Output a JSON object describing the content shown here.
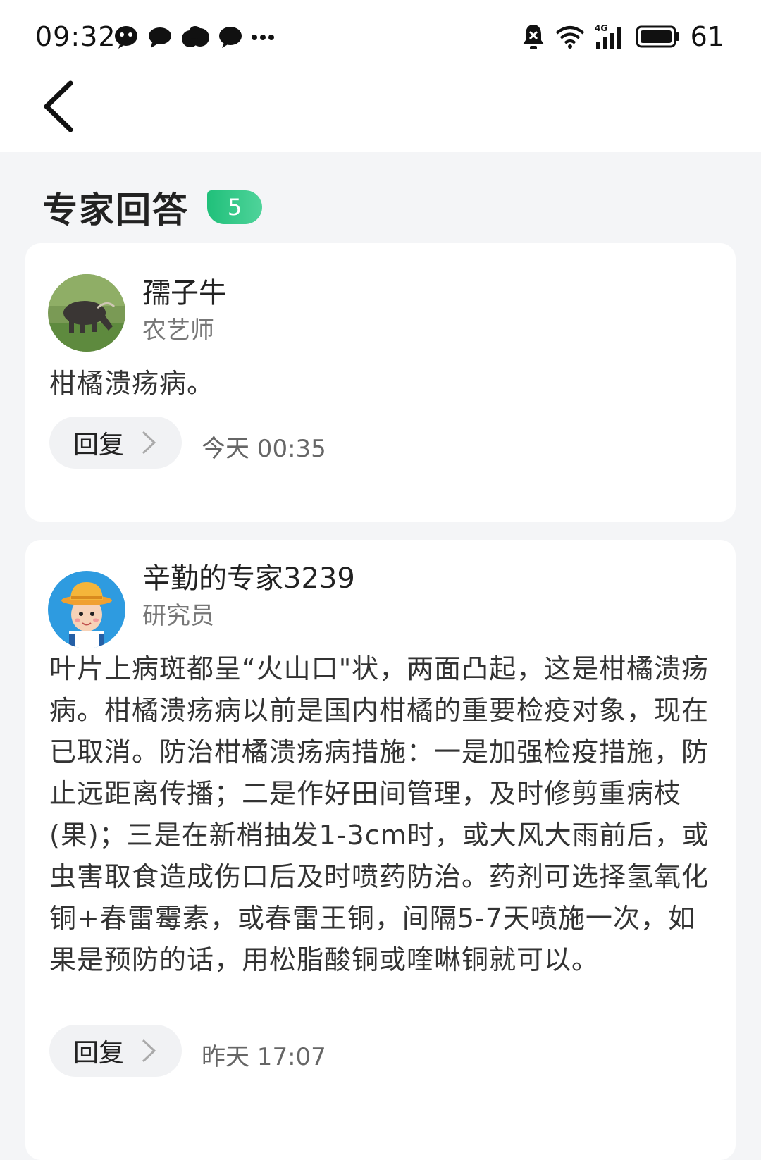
{
  "status_bar": {
    "time": "09:32",
    "battery": "61",
    "network": "4G",
    "icons": [
      "qq-icon",
      "chat-icon",
      "cloud-icon",
      "message-icon",
      "more-dots-icon",
      "mute-bell-icon",
      "wifi-icon",
      "signal-icon",
      "battery-icon"
    ]
  },
  "nav": {
    "back_icon": "back-arrow-icon"
  },
  "section": {
    "title": "专家回答",
    "count": "5"
  },
  "answers": [
    {
      "name": "孺子牛",
      "role": "农艺师",
      "avatar": "buffalo-avatar",
      "text": "柑橘溃疡病。",
      "reply_label": "回复",
      "time": "今天 00:35"
    },
    {
      "name": "辛勤的专家3239",
      "role": "研究员",
      "avatar": "farmer-avatar",
      "text": "叶片上病斑都呈“火山口\"状，两面凸起，这是柑橘溃疡病。柑橘溃疡病以前是国内柑橘的重要检疫对象，现在已取消。防治柑橘溃疡病措施：一是加强检疫措施，防止远距离传播；二是作好田间管理，及时修剪重病枝(果)；三是在新梢抽发1-3cm时，或大风大雨前后，或虫害取食造成伤口后及时喷药防治。药剂可选择氢氧化铜+春雷霉素，或春雷王铜，间隔5-7天喷施一次，如果是预防的话，用松脂酸铜或喹啉铜就可以。",
      "reply_label": "回复",
      "time": "昨天 17:07"
    }
  ],
  "colors": {
    "accent": "#20c07a",
    "background": "#f4f5f7",
    "card": "#ffffff"
  }
}
